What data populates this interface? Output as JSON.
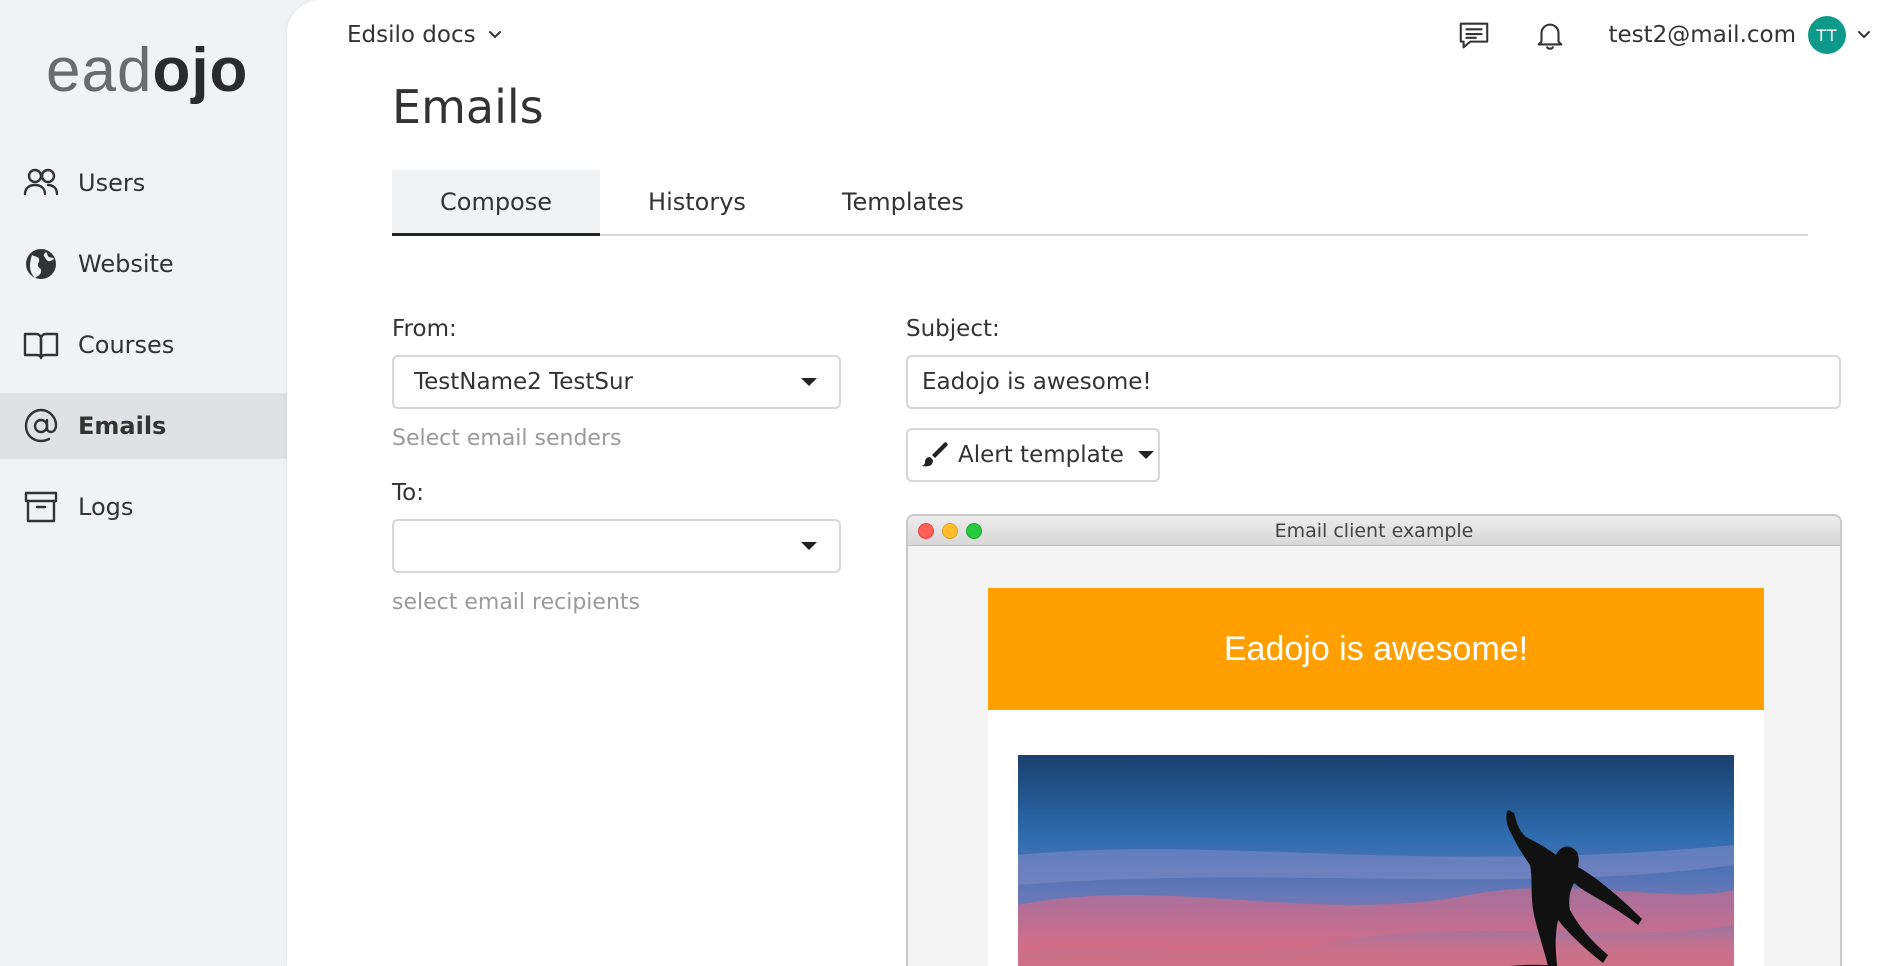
{
  "app": {
    "logo_part1": "ead",
    "logo_part2": "ojo",
    "workspace": "Edsilo docs",
    "user_email": "test2@mail.com",
    "user_initials": "TT"
  },
  "sidebar": {
    "items": [
      {
        "label": "Users",
        "icon": "users-icon"
      },
      {
        "label": "Website",
        "icon": "globe-icon"
      },
      {
        "label": "Courses",
        "icon": "book-icon"
      },
      {
        "label": "Emails",
        "icon": "at-icon",
        "active": true
      },
      {
        "label": "Logs",
        "icon": "archive-icon"
      }
    ]
  },
  "page": {
    "title": "Emails",
    "tabs": [
      {
        "label": "Compose",
        "active": true
      },
      {
        "label": "Historys"
      },
      {
        "label": "Templates"
      }
    ]
  },
  "compose": {
    "from_label": "From:",
    "from_value": "TestName2 TestSur",
    "from_hint": "Select email senders",
    "to_label": "To:",
    "to_value": "",
    "to_hint": "select email recipients",
    "subject_label": "Subject:",
    "subject_value": "Eadojo is awesome!",
    "template_button": "Alert template"
  },
  "preview": {
    "window_title": "Email client example",
    "header_text": "Eadojo is awesome!",
    "header_color": "#ff9f00"
  },
  "colors": {
    "avatar": "#0e9a8a",
    "sidebar_bg": "#f1f2f4",
    "active_nav_bg": "#dfe1e4"
  }
}
